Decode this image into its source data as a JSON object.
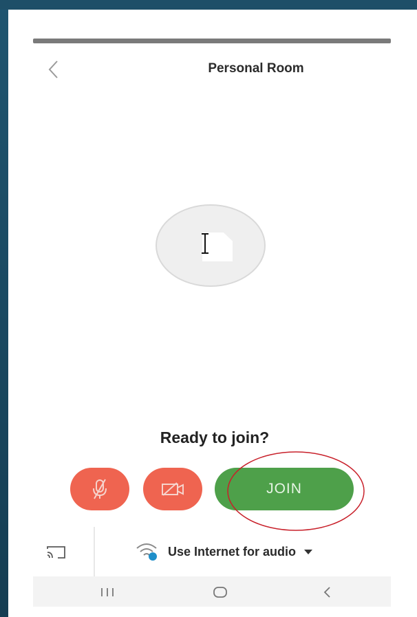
{
  "header": {
    "title": "Personal Room",
    "back_icon": "chevron-left-icon"
  },
  "avatar": {
    "icon": "document-icon",
    "cursor_icon": "text-cursor-icon"
  },
  "join_panel": {
    "prompt": "Ready to join?",
    "mute_icon": "microphone-muted-icon",
    "video_icon": "video-off-icon",
    "join_label": "JOIN",
    "colors": {
      "mute_bg": "#ef6450",
      "video_bg": "#ef6450",
      "join_bg": "#4ea04a",
      "annotation": "#c8202a"
    }
  },
  "bottom_bar": {
    "cast_icon": "cast-icon",
    "audio_icon": "wifi-audio-icon",
    "audio_label": "Use Internet for audio",
    "dropdown_icon": "caret-down-icon"
  },
  "nav_bar": {
    "items": [
      {
        "name": "recents",
        "icon": "recents-icon"
      },
      {
        "name": "home",
        "icon": "home-icon"
      },
      {
        "name": "back",
        "icon": "back-nav-icon"
      }
    ]
  }
}
